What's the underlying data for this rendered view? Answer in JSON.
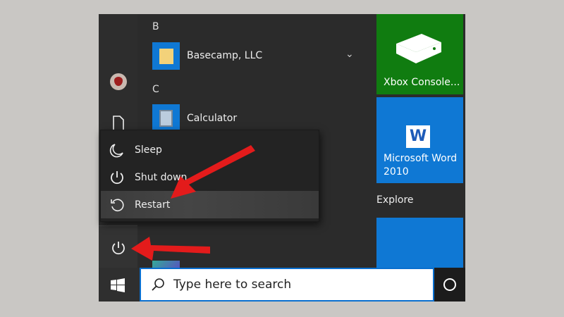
{
  "app_list": {
    "sections": [
      {
        "letter": "B",
        "apps": [
          {
            "label": "Basecamp, LLC",
            "icon": "folder-icon",
            "expandable": true
          }
        ]
      },
      {
        "letter": "C",
        "apps": [
          {
            "label": "Calculator",
            "icon": "calculator-icon"
          }
        ]
      }
    ]
  },
  "tiles": {
    "xbox": {
      "label": "Xbox Console...",
      "color": "#107c10"
    },
    "word": {
      "label_line1": "Microsoft Word",
      "label_line2": "2010",
      "color": "#0f78d4"
    },
    "group_label": "Explore"
  },
  "power_menu": {
    "items": [
      {
        "label": "Sleep",
        "icon": "moon-icon"
      },
      {
        "label": "Shut down",
        "icon": "power-icon"
      },
      {
        "label": "Restart",
        "icon": "restart-icon",
        "highlighted": true
      }
    ]
  },
  "taskbar": {
    "search_placeholder": "Type here to search"
  },
  "annotations": {
    "arrow_color": "#e31b1b"
  }
}
